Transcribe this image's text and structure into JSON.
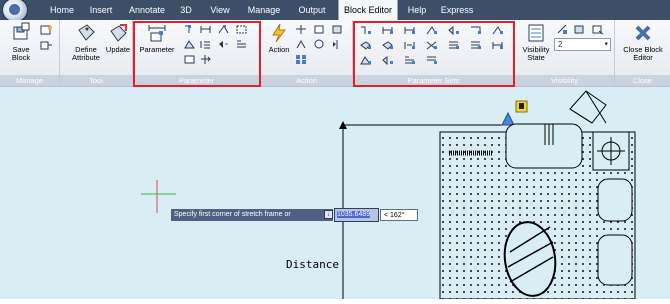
{
  "tabs": [
    {
      "label": "Home",
      "active": false
    },
    {
      "label": "Insert",
      "active": false
    },
    {
      "label": "Annotate",
      "active": false
    },
    {
      "label": "3D",
      "active": false
    },
    {
      "label": "View",
      "active": false
    },
    {
      "label": "Manage",
      "active": false
    },
    {
      "label": "Output",
      "active": false
    },
    {
      "label": "Block Editor",
      "active": true
    },
    {
      "label": "Help",
      "active": false
    },
    {
      "label": "Express",
      "active": false
    }
  ],
  "panels": {
    "manage": {
      "title": "Manage",
      "save_line1": "Save",
      "save_line2": "Block"
    },
    "tool": {
      "title": "Tool",
      "define_line1": "Define",
      "define_line2": "Attribute",
      "update": "Update"
    },
    "parameter": {
      "title": "Parameter",
      "parameter_btn": "Parameter"
    },
    "action": {
      "title": "Action",
      "action_btn": "Action"
    },
    "parameter_sets": {
      "title": "Parameter Sets"
    },
    "visibility": {
      "title": "Visibility",
      "vis_line1": "Visibility",
      "vis_line2": "State",
      "state_value": "2"
    },
    "close": {
      "title": "Close",
      "close_line1": "Close Block",
      "close_line2": "Editor"
    }
  },
  "command": {
    "prompt": "Specify first corner of stretch frame or",
    "distance_value": "1035.6489",
    "angle_value": "< 162°",
    "distance_label": "Distance"
  },
  "colors": {
    "highlight_box": "#e0202a",
    "canvas_bg": "#d9eef4",
    "tooltip_bg": "#4f6085"
  }
}
